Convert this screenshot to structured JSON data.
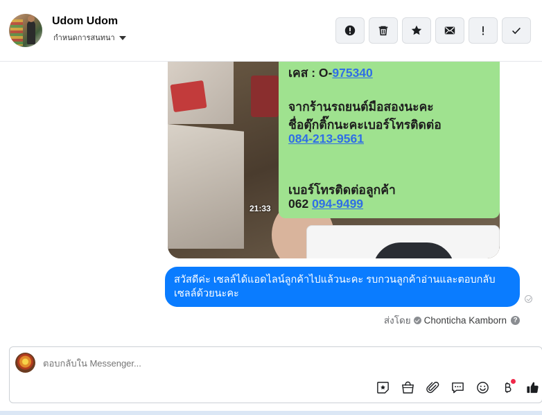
{
  "header": {
    "name": "Udom Udom",
    "subtitle": "กำหนดการสนทนา",
    "actions": [
      {
        "name": "report-icon"
      },
      {
        "name": "trash-icon"
      },
      {
        "name": "star-icon"
      },
      {
        "name": "mail-icon"
      },
      {
        "name": "important-icon"
      },
      {
        "name": "check-icon"
      }
    ]
  },
  "attachment": {
    "timestamp": "21:33",
    "lines": {
      "case_prefix": "เคส : O-",
      "case_number": "975340",
      "line2": "จากร้านรถยนต์มือสองนะคะ",
      "line3": "ชื่อตุ๊กติ๊กนะคะเบอร์โทรติดต่อ",
      "phone1": "084-213-9561",
      "line5": "เบอร์โทรติดต่อลูกค้า",
      "phone2_prefix": "062",
      "phone2": "094-9499"
    }
  },
  "message": {
    "text": "สวัสดีค่ะ เซลล์ได้แอดไลน์ลูกค้าไปแล้วนะคะ รบกวนลูกค้าอ่านและตอบกลับ เซลล์ด้วยนะคะ",
    "sent_by_label": "ส่งโดย",
    "sender": "Chonticha Kamborn"
  },
  "composer": {
    "placeholder": "ตอบกลับใน Messenger...",
    "tools": [
      "sticker-icon",
      "shop-icon",
      "attach-icon",
      "saved-reply-icon",
      "emoji-icon",
      "baht-icon",
      "like-icon"
    ]
  },
  "colors": {
    "bubble": "#0a7cff",
    "attachment_green": "#9fe28f",
    "link": "#2f6ee6",
    "notification_dot": "#f02849"
  }
}
